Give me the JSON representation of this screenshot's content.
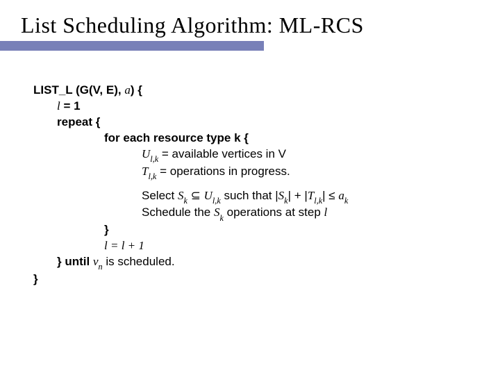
{
  "title": "List Scheduling Algorithm: ML-RCS",
  "algo": {
    "sig_prefix": "LIST_L (G(V, E), ",
    "sig_a": "a",
    "sig_suffix": ") {",
    "l_eq_1_l": "l",
    "l_eq_1_rest": " = 1",
    "repeat": "repeat {",
    "for_each": "for each resource type k {",
    "U": "U",
    "lk": "l,k",
    "avail": " = available vertices in V",
    "T": "T",
    "ops_prog": " = operations in progress.",
    "select": "Select ",
    "S": "S",
    "k": "k",
    "subset": " ⊆ ",
    "such_that": " such that  |",
    "plus": "| + |",
    "leq": "| ≤ ",
    "a": "a",
    "schedule": "Schedule the ",
    "ops_at": " operations at step ",
    "l": "l",
    "close_inner": "}",
    "inc_l": "l  = l  + 1",
    "until_prefix": "} until ",
    "v": "v",
    "n": "n",
    "until_suffix": " is scheduled.",
    "close_outer": "}"
  }
}
